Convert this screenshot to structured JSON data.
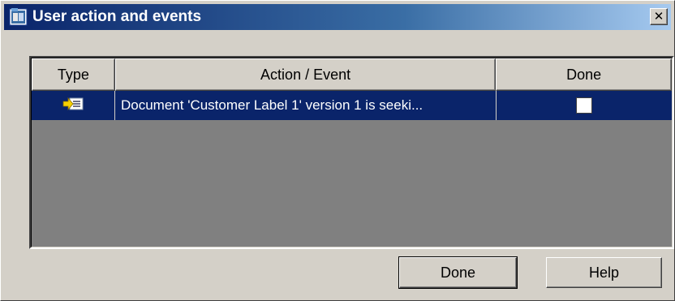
{
  "window": {
    "title": "User action and events",
    "close_glyph": "✕",
    "icon": "app-icon"
  },
  "table": {
    "columns": [
      "Type",
      "Action / Event",
      "Done"
    ],
    "rows": [
      {
        "type_icon": "event-arrow-icon",
        "action": "Document 'Customer Label 1' version 1 is seeki...",
        "done": false,
        "selected": true
      }
    ]
  },
  "buttons": {
    "done_label": "Done",
    "help_label": "Help"
  },
  "colors": {
    "selection": "#0a246a",
    "face": "#d4d0c8",
    "list_bg": "#808080"
  }
}
